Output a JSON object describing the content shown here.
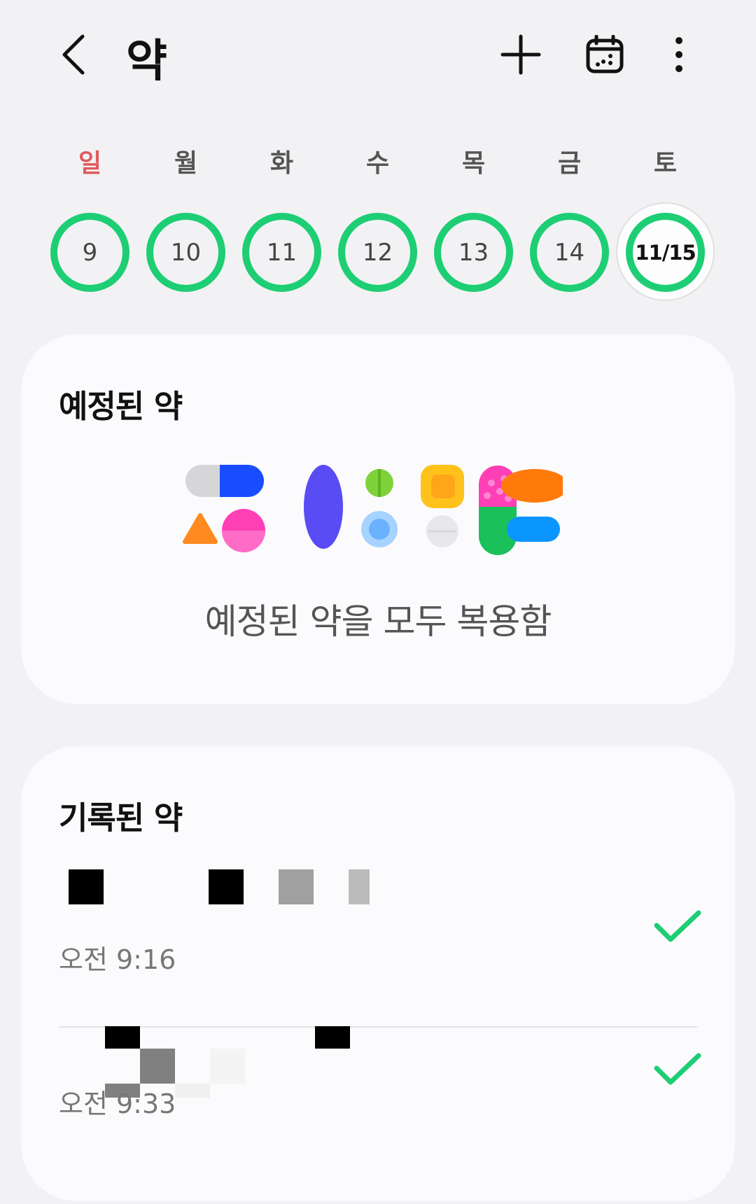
{
  "header": {
    "title": "약",
    "back_icon": "chevron-left-icon",
    "add_icon": "plus-icon",
    "calendar_icon": "calendar-icon",
    "more_icon": "more-vertical-icon"
  },
  "week": {
    "days": [
      {
        "name": "일",
        "date": "9"
      },
      {
        "name": "월",
        "date": "10"
      },
      {
        "name": "화",
        "date": "11"
      },
      {
        "name": "수",
        "date": "12"
      },
      {
        "name": "목",
        "date": "13"
      },
      {
        "name": "금",
        "date": "14"
      },
      {
        "name": "토",
        "date": "11/15"
      }
    ],
    "ring_color": "#1ece74",
    "sunday_color": "#e05a5a"
  },
  "scheduled": {
    "title": "예정된 약",
    "empty_message": "예정된 약을 모두 복용함",
    "illustration_icon": "pills-illustration"
  },
  "logged": {
    "title": "기록된 약",
    "entries": [
      {
        "name": "",
        "time": "오전 9:16",
        "status_icon": "check-icon"
      },
      {
        "name": "",
        "time": "오전 9:33",
        "status_icon": "check-icon"
      }
    ],
    "check_color": "#1ece74"
  }
}
